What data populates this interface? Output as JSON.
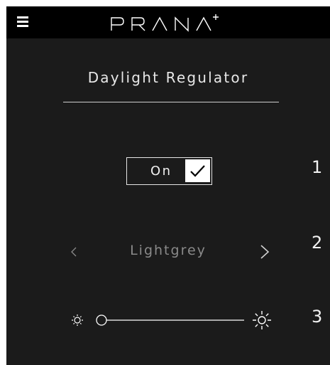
{
  "header": {
    "logo_text": "PRANA",
    "logo_superscript": "+",
    "menu_icon": "hamburger-menu-icon"
  },
  "page": {
    "title": "Daylight Regulator"
  },
  "rows": [
    {
      "number": "1",
      "control": "toggle",
      "label": "On",
      "checked": true
    },
    {
      "number": "2",
      "control": "selector",
      "value": "Lightgrey"
    },
    {
      "number": "3",
      "control": "slider",
      "value": 0,
      "min_icon": "sun-small-icon",
      "max_icon": "sun-large-icon"
    }
  ],
  "colors": {
    "background": "#1b1b1b",
    "topbar": "#000000",
    "text": "#ffffff",
    "muted_text": "#8a8a8a"
  }
}
